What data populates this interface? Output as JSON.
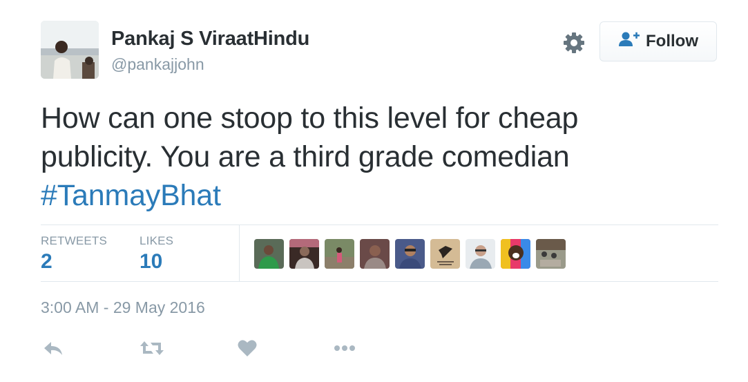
{
  "user": {
    "display_name": "Pankaj S ViraatHindu",
    "handle": "@pankajjohn",
    "avatar_icon": "user-avatar-photo"
  },
  "header": {
    "settings_icon": "gear-icon",
    "follow_label": "Follow",
    "follow_icon": "add-user-icon"
  },
  "tweet": {
    "line1": "How can one stoop to this level for cheap",
    "line2": "publicity. You are a third grade comedian",
    "hashtag": "#TanmayBhat"
  },
  "stats": {
    "retweets_label": "RETWEETS",
    "retweets_count": "2",
    "likes_label": "LIKES",
    "likes_count": "10"
  },
  "likers_count_shown": 9,
  "timestamp": "3:00 AM - 29 May 2016",
  "actions": {
    "reply_icon": "reply-icon",
    "retweet_icon": "retweet-icon",
    "like_icon": "heart-icon",
    "more_icon": "more-dots-icon"
  },
  "colors": {
    "text": "#292f33",
    "secondary": "#8899a6",
    "link": "#2b7bb9",
    "border": "#e1e8ed",
    "follow_icon": "#2b7bb9",
    "action_icon": "#aab8c2"
  }
}
